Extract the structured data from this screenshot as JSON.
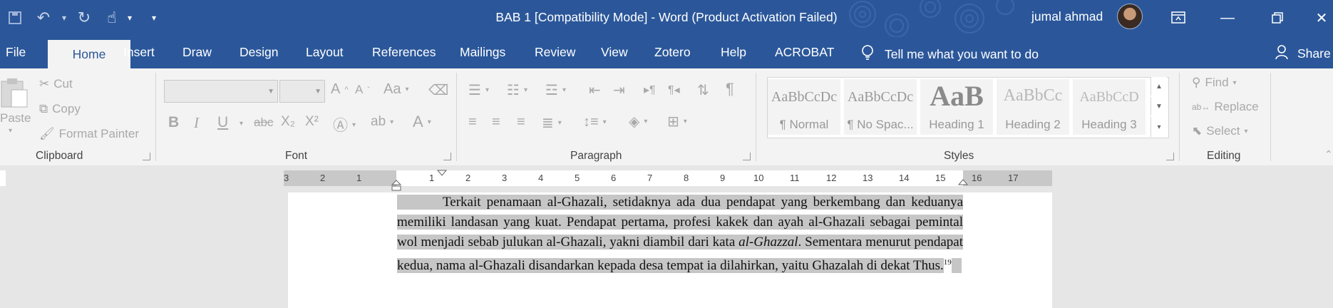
{
  "app": {
    "document_title": "BAB 1 [Compatibility Mode]  -  Word (Product Activation Failed)",
    "user_name": "jumal ahmad"
  },
  "ribbon_tabs": {
    "file": "File",
    "home": "Home",
    "insert": "Insert",
    "draw": "Draw",
    "design": "Design",
    "layout": "Layout",
    "references": "References",
    "mailings": "Mailings",
    "review": "Review",
    "view": "View",
    "zotero": "Zotero",
    "help": "Help",
    "acrobat": "ACROBAT"
  },
  "tell_me": "Tell me what you want to do",
  "share": "Share",
  "clipboard": {
    "paste": "Paste",
    "cut": "Cut",
    "copy": "Copy",
    "format_painter": "Format Painter",
    "label": "Clipboard"
  },
  "font": {
    "label": "Font",
    "font_name": "",
    "font_size": "",
    "bold": "B",
    "italic": "I",
    "underline": "U",
    "strike": "abc",
    "subscript": "X₂",
    "superscript": "X²",
    "font_color": "A",
    "change_case": "Aa",
    "grow": "A",
    "shrink": "A"
  },
  "paragraph": {
    "label": "Paragraph"
  },
  "styles": {
    "label": "Styles",
    "items": [
      {
        "sample": "AaBbCcDc",
        "name": "¶ Normal"
      },
      {
        "sample": "AaBbCcDc",
        "name": "¶ No Spac..."
      },
      {
        "sample": "AaB",
        "name": "Heading 1"
      },
      {
        "sample": "AaBbCc",
        "name": "Heading 2"
      },
      {
        "sample": "AaBbCcD",
        "name": "Heading 3"
      }
    ]
  },
  "editing": {
    "label": "Editing",
    "find": "Find",
    "replace": "Replace",
    "select": "Select"
  },
  "ruler": {
    "labels": [
      "3",
      "2",
      "1",
      "1",
      "2",
      "3",
      "4",
      "5",
      "6",
      "7",
      "8",
      "9",
      "10",
      "11",
      "12",
      "13",
      "14",
      "15",
      "16",
      "17"
    ]
  },
  "document": {
    "paragraph_text": "Terkait penamaan al-Ghazali, setidaknya ada dua pendapat yang berkembang dan keduanya memiliki landasan yang kuat. Pendapat pertama, profesi kakek dan ayah al-Ghazali sebagai pemintal wol menjadi sebab julukan al-Ghazali, yakni diambil dari kata ",
    "italic_word": "al-Ghazzal",
    "paragraph_text_2": ". Sementara menurut pendapat kedua, nama al-Ghazali disandarkan kepada desa tempat ia dilahirkan, yaitu Ghazalah di dekat Thus.",
    "footnote_ref": "19"
  },
  "colors": {
    "title_bar": "#2b579a",
    "ribbon_bg": "#f3f3f3",
    "selection": "#c6c6c6"
  }
}
